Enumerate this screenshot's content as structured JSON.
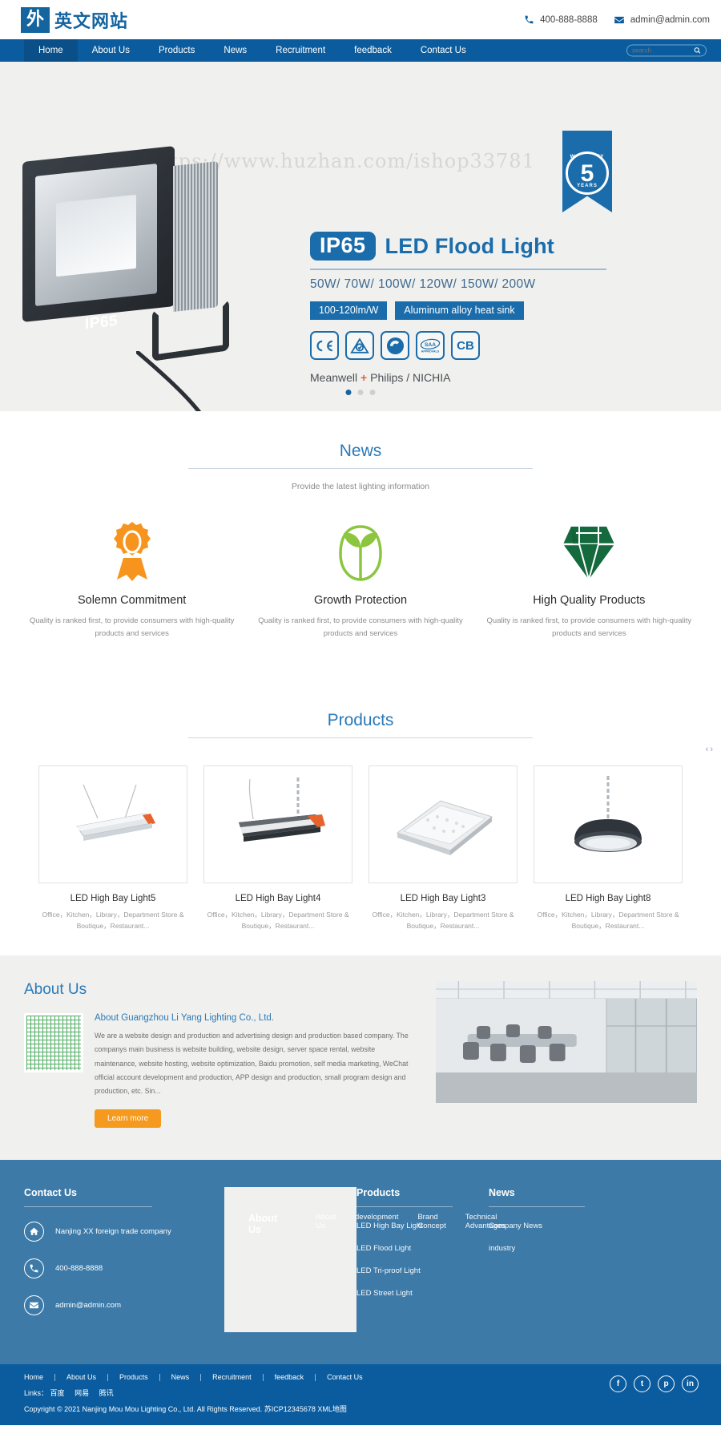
{
  "header": {
    "logo_mark": "外",
    "logo_text": "英文网站",
    "phone": "400-888-8888",
    "email": "admin@admin.com",
    "phone_icon": "phone-icon",
    "email_icon": "envelope-icon"
  },
  "nav": {
    "items": [
      {
        "label": "Home",
        "active": true
      },
      {
        "label": "About Us",
        "active": false
      },
      {
        "label": "Products",
        "active": false
      },
      {
        "label": "News",
        "active": false
      },
      {
        "label": "Recruitment",
        "active": false
      },
      {
        "label": "feedback",
        "active": false
      },
      {
        "label": "Contact Us",
        "active": false
      }
    ],
    "search_placeholder": "search",
    "search_value": ""
  },
  "hero": {
    "watermark": "https://www.huzhan.com/ishop33781",
    "ip_badge": "IP65",
    "title": "LED Flood Light",
    "wattage": "50W/ 70W/ 100W/ 120W/ 150W/ 200W",
    "tags": [
      "100-120lm/W",
      "Aluminum alloy heat sink"
    ],
    "certs": [
      "CE",
      "RCM",
      "C-Tick",
      "SAA",
      "CB"
    ],
    "brand_prefix": "Meanwell ",
    "brand_plus": "+",
    "brand_suffix": " Philips / NICHIA",
    "lamp_label": "IP65",
    "warranty": {
      "top": "WARRANTY",
      "number": "5",
      "bottom": "YEARS"
    },
    "dots": [
      true,
      false,
      false
    ]
  },
  "news": {
    "title": "News",
    "subtitle": "Provide the latest lighting information",
    "features": [
      {
        "icon": "award-ribbon-icon",
        "title": "Solemn Commitment",
        "desc": "Quality is ranked first, to provide consumers with high-quality products and services"
      },
      {
        "icon": "sprout-leaf-icon",
        "title": "Growth Protection",
        "desc": "Quality is ranked first, to provide consumers with high-quality products and services"
      },
      {
        "icon": "diamond-icon",
        "title": "High Quality Products",
        "desc": "Quality is ranked first, to provide consumers with high-quality products and services"
      }
    ]
  },
  "products": {
    "title": "Products",
    "prev_label": "‹",
    "next_label": "›",
    "items": [
      {
        "name": "LED High Bay Light5",
        "desc": "Office，Kitchen，Library，Department Store & Boutique，Restaurant..."
      },
      {
        "name": "LED High Bay Light4",
        "desc": "Office，Kitchen，Library，Department Store & Boutique，Restaurant..."
      },
      {
        "name": "LED High Bay Light3",
        "desc": "Office，Kitchen，Library，Department Store & Boutique，Restaurant..."
      },
      {
        "name": "LED High Bay Light8",
        "desc": "Office，Kitchen，Library，Department Store & Boutique，Restaurant..."
      }
    ]
  },
  "about": {
    "title": "About Us",
    "subtitle": "About Guangzhou Li Yang Lighting Co., Ltd.",
    "text": "We are a website design and production and advertising design and production based company. The companys main business is website building, website design, server space rental, website maintenance, website hosting, website optimization, Baidu promotion, self media marketing, WeChat official account development and production, APP design and production, small program design and production, etc. Sin...",
    "button": "Learn more",
    "qr_name": "qr-code"
  },
  "footer": {
    "columns": [
      {
        "title": "Contact Us",
        "type": "contact",
        "rows": [
          {
            "icon": "home-icon",
            "text": "Nanjing XX foreign trade company"
          },
          {
            "icon": "phone-icon",
            "text": "400-888-8888"
          },
          {
            "icon": "envelope-icon",
            "text": "admin@admin.com"
          }
        ]
      },
      {
        "title": "About Us",
        "type": "links",
        "links": [
          "About Us",
          "development",
          "Brand Concept",
          "Technical Advantages"
        ]
      },
      {
        "title": "Products",
        "type": "links",
        "links": [
          "LED High Bay Light",
          "LED Flood Light",
          "LED Tri-proof Light",
          "LED Street Light"
        ]
      },
      {
        "title": "News",
        "type": "links",
        "links": [
          "Company News",
          "industry"
        ]
      }
    ]
  },
  "bottom": {
    "nav": [
      "Home",
      "About Us",
      "Products",
      "News",
      "Recruitment",
      "feedback",
      "Contact Us"
    ],
    "links_label": "Links：",
    "links": [
      "百度",
      "网易",
      "腾讯"
    ],
    "copyright": "Copyright © 2021 Nanjing Mou Mou Lighting Co., Ltd. All Rights Reserved. 苏ICP12345678 XML地图",
    "socials": [
      {
        "name": "facebook-icon",
        "glyph": "f"
      },
      {
        "name": "twitter-icon",
        "glyph": "t"
      },
      {
        "name": "pinterest-icon",
        "glyph": "p"
      },
      {
        "name": "linkedin-icon",
        "glyph": "in"
      }
    ]
  },
  "colors": {
    "brand_blue": "#0b5c9e",
    "accent_blue": "#1a6cab",
    "footer_blue": "#3d7aa8",
    "orange": "#f59a1f",
    "green": "#7cb342"
  }
}
